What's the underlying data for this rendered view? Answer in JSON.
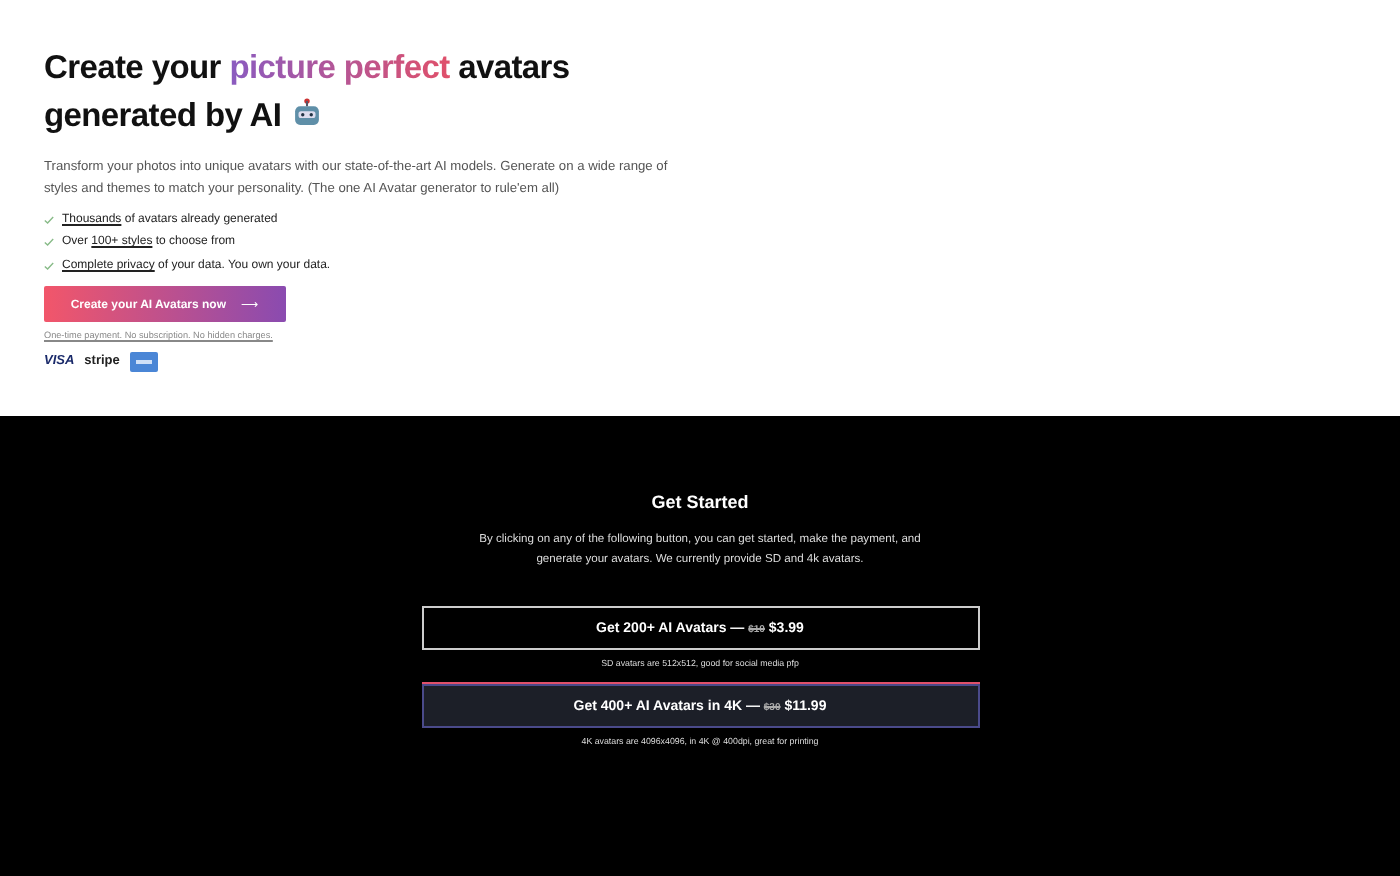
{
  "hero": {
    "title_start": "Create your",
    "title_highlight": "picture perfect",
    "title_end": "avatars generated by AI",
    "description": "Transform your photos into unique avatars with our state-of-the-art AI models. Generate on a wide range of styles and themes to match your personality. (The one AI Avatar generator to rule'em all)",
    "features": [
      {
        "link": "Thousands",
        "after": " of avatars already generated"
      },
      {
        "before": "Over ",
        "link": "100+ styles",
        "after": " to choose from"
      },
      {
        "link": "Complete privacy",
        "after": " of your data. You own your data."
      }
    ],
    "cta": "Create your AI Avatars now",
    "cta_arrow": "⟶",
    "note": "One-time payment. No subscription. No hidden charges.",
    "payment_logos": [
      "VISA",
      "stripe"
    ]
  },
  "get_started": {
    "title": "Get Started",
    "description": "By clicking on any of the following button, you can get started, make the payment, and generate your avatars. We currently provide SD and 4k avatars.",
    "plans": [
      {
        "kind": "outline",
        "label": "Get 200+ AI Avatars —",
        "old_price": "$10",
        "price": "$3.99",
        "note": "SD avatars are 512x512, good for social media pfp"
      },
      {
        "kind": "glow",
        "label": "Get 400+ AI Avatars in 4K —",
        "old_price": "$30",
        "price": "$11.99",
        "note": "4K avatars are 4096x4096, in 4K @ 400dpi, great for printing"
      }
    ]
  }
}
